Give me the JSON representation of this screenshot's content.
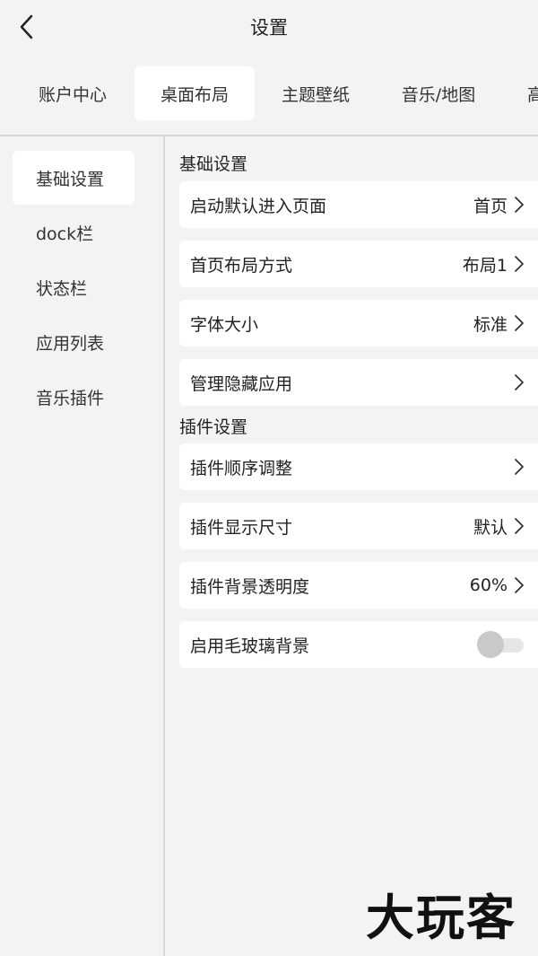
{
  "header": {
    "title": "设置"
  },
  "tabs": [
    {
      "label": "账户中心"
    },
    {
      "label": "桌面布局"
    },
    {
      "label": "主题壁纸"
    },
    {
      "label": "音乐/地图"
    },
    {
      "label": "高"
    }
  ],
  "sidebar": {
    "items": [
      {
        "label": "基础设置"
      },
      {
        "label": "dock栏"
      },
      {
        "label": "状态栏"
      },
      {
        "label": "应用列表"
      },
      {
        "label": "音乐插件"
      }
    ]
  },
  "basic": {
    "title": "基础设置",
    "rows": [
      {
        "label": "启动默认进入页面",
        "value": "首页"
      },
      {
        "label": "首页布局方式",
        "value": "布局1"
      },
      {
        "label": "字体大小",
        "value": "标准"
      },
      {
        "label": "管理隐藏应用",
        "value": ""
      }
    ]
  },
  "widgets": {
    "title": "插件设置",
    "rows": [
      {
        "label": "插件顺序调整",
        "value": ""
      },
      {
        "label": "插件显示尺寸",
        "value": "默认"
      },
      {
        "label": "插件背景透明度",
        "value": "60%"
      },
      {
        "label": "启用毛玻璃背景",
        "toggle": false
      }
    ]
  },
  "watermark": {
    "text": "大玩客"
  },
  "colors": {
    "background": "#f3f3f3",
    "card": "#ffffff",
    "toggle_off": "#c9c9c9"
  }
}
